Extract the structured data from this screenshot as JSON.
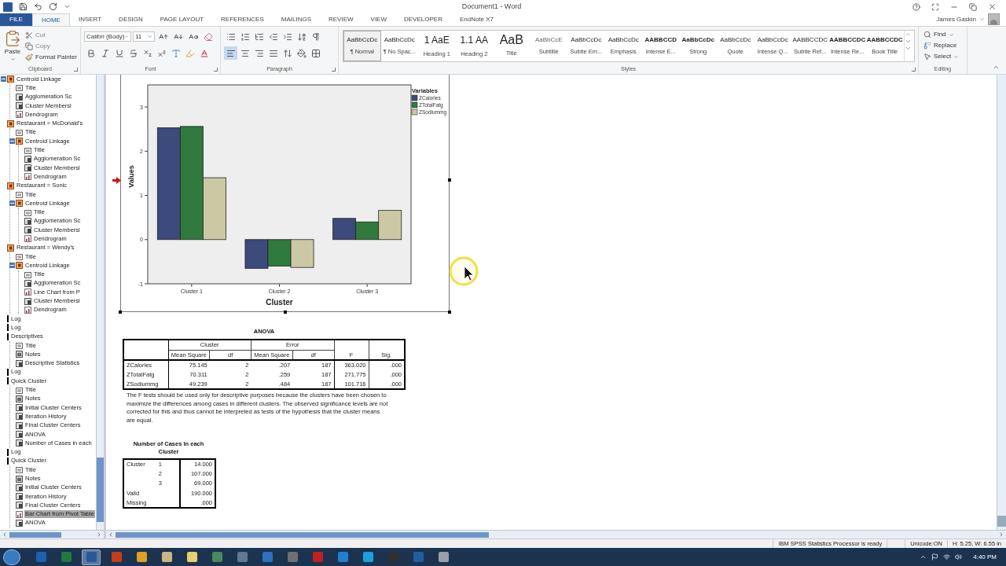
{
  "window": {
    "title": "Document1 - Word"
  },
  "tabs": [
    {
      "label": "FILE",
      "kind": "file",
      "selected": false
    },
    {
      "label": "HOME",
      "kind": "tab",
      "selected": true
    },
    {
      "label": "INSERT",
      "kind": "tab",
      "selected": false
    },
    {
      "label": "DESIGN",
      "kind": "tab",
      "selected": false
    },
    {
      "label": "PAGE LAYOUT",
      "kind": "tab",
      "selected": false
    },
    {
      "label": "REFERENCES",
      "kind": "tab",
      "selected": false
    },
    {
      "label": "MAILINGS",
      "kind": "tab",
      "selected": false
    },
    {
      "label": "REVIEW",
      "kind": "tab",
      "selected": false
    },
    {
      "label": "VIEW",
      "kind": "tab",
      "selected": false
    },
    {
      "label": "DEVELOPER",
      "kind": "tab",
      "selected": false
    },
    {
      "label": "EndNote X7",
      "kind": "tab",
      "selected": false
    }
  ],
  "user": "James Gaskin",
  "ribbon": {
    "clipboard": {
      "label": "Clipboard",
      "paste": "Paste",
      "cut": "Cut",
      "copy": "Copy",
      "format_painter": "Format Painter"
    },
    "font": {
      "label": "Font",
      "font_name": "Calibri (Body)",
      "font_size": "11"
    },
    "paragraph": {
      "label": "Paragraph"
    },
    "styles": {
      "label": "Styles",
      "items": [
        {
          "preview": "AaBbCcDc",
          "label": "¶ Normal",
          "selected": true
        },
        {
          "preview": "AaBbCcDc",
          "label": "¶ No Spac...",
          "selected": false
        },
        {
          "preview": "1 AaE",
          "label": "Heading 1",
          "selected": false
        },
        {
          "preview": "1.1 AA",
          "label": "Heading 2",
          "selected": false
        },
        {
          "preview": "AaB",
          "label": "Title",
          "selected": false
        },
        {
          "preview": "AaBbCcE",
          "label": "Subtitle",
          "selected": false
        },
        {
          "preview": "AaBbCcDc",
          "label": "Subtle Em...",
          "selected": false
        },
        {
          "preview": "AaBbCcDc",
          "label": "Emphasis",
          "selected": false
        },
        {
          "preview": "AABBCCD",
          "label": "Intense E...",
          "selected": false
        },
        {
          "preview": "AaBbCcDc",
          "label": "Strong",
          "selected": false
        },
        {
          "preview": "AaBbCcDc",
          "label": "Quote",
          "selected": false
        },
        {
          "preview": "AaBbCcDc",
          "label": "Intense Q...",
          "selected": false
        },
        {
          "preview": "AABBCCDC",
          "label": "Subtle Ref...",
          "selected": false
        },
        {
          "preview": "AABBCCDC",
          "label": "Intense Re...",
          "selected": false
        },
        {
          "preview": "AABBCCDC",
          "label": "Book Title",
          "selected": false
        }
      ]
    },
    "editing": {
      "label": "Editing",
      "find": "Find",
      "replace": "Replace",
      "select": "Select"
    }
  },
  "outline": [
    {
      "label": "Centroid Linkage",
      "kind": "folder",
      "expanded": true,
      "selected": false,
      "children": [
        {
          "label": "Title",
          "kind": "title",
          "selected": false
        },
        {
          "label": "Agglomeration Sc",
          "kind": "table",
          "selected": false
        },
        {
          "label": "Cluster Membersl",
          "kind": "table",
          "selected": false
        },
        {
          "label": "Dendrogram",
          "kind": "chart",
          "selected": false
        }
      ]
    },
    {
      "label": "Restaurant = McDonald's",
      "kind": "folder",
      "selected": false,
      "children": [
        {
          "label": "Title",
          "kind": "title",
          "selected": false
        },
        {
          "label": "Centroid Linkage",
          "kind": "folder",
          "expanded": true,
          "selected": false,
          "children": [
            {
              "label": "Title",
              "kind": "title",
              "selected": false
            },
            {
              "label": "Agglomeration Sc",
              "kind": "table",
              "selected": false
            },
            {
              "label": "Cluster Membersl",
              "kind": "table",
              "selected": false
            },
            {
              "label": "Dendrogram",
              "kind": "chart",
              "selected": false
            }
          ]
        }
      ]
    },
    {
      "label": "Restaurant = Sonic",
      "kind": "folder",
      "selected": false,
      "children": [
        {
          "label": "Title",
          "kind": "title",
          "selected": false
        },
        {
          "label": "Centroid Linkage",
          "kind": "folder",
          "expanded": true,
          "selected": false,
          "children": [
            {
              "label": "Title",
              "kind": "title",
              "selected": false
            },
            {
              "label": "Agglomeration Sc",
              "kind": "table",
              "selected": false
            },
            {
              "label": "Cluster Membersl",
              "kind": "table",
              "selected": false
            },
            {
              "label": "Dendrogram",
              "kind": "chart",
              "selected": false
            }
          ]
        }
      ]
    },
    {
      "label": "Restaurant = Wendy's",
      "kind": "folder",
      "selected": false,
      "children": [
        {
          "label": "Title",
          "kind": "title",
          "selected": false
        },
        {
          "label": "Centroid Linkage",
          "kind": "folder",
          "expanded": true,
          "selected": false,
          "children": [
            {
              "label": "Title",
              "kind": "title",
              "selected": false
            },
            {
              "label": "Agglomeration Sc",
              "kind": "table",
              "selected": false
            },
            {
              "label": "Line Chart from P",
              "kind": "chart",
              "selected": false
            },
            {
              "label": "Cluster Membersl",
              "kind": "table",
              "selected": false
            },
            {
              "label": "Dendrogram",
              "kind": "chart",
              "selected": false
            }
          ]
        }
      ]
    },
    {
      "label": "Log",
      "kind": "log",
      "selected": false
    },
    {
      "label": "Log",
      "kind": "log",
      "selected": false
    },
    {
      "label": "Descriptives",
      "kind": "log",
      "selected": false,
      "children": [
        {
          "label": "Title",
          "kind": "title",
          "selected": false
        },
        {
          "label": "Notes",
          "kind": "notes",
          "selected": false
        },
        {
          "label": "Descriptive Statistics",
          "kind": "table",
          "selected": false
        }
      ]
    },
    {
      "label": "Log",
      "kind": "log",
      "selected": false
    },
    {
      "label": "Quick Cluster",
      "kind": "log",
      "selected": false,
      "children": [
        {
          "label": "Title",
          "kind": "title",
          "selected": false
        },
        {
          "label": "Notes",
          "kind": "notes",
          "selected": false
        },
        {
          "label": "Initial Cluster Centers",
          "kind": "table",
          "selected": false
        },
        {
          "label": "Iteration History",
          "kind": "table",
          "selected": false
        },
        {
          "label": "Final Cluster Centers",
          "kind": "table",
          "selected": false
        },
        {
          "label": "ANOVA",
          "kind": "table",
          "selected": false
        },
        {
          "label": "Number of Cases in each",
          "kind": "table",
          "selected": false
        }
      ]
    },
    {
      "label": "Log",
      "kind": "log",
      "selected": false
    },
    {
      "label": "Quick Cluster",
      "kind": "log",
      "selected": false,
      "children": [
        {
          "label": "Title",
          "kind": "title",
          "selected": false
        },
        {
          "label": "Notes",
          "kind": "notes",
          "selected": false
        },
        {
          "label": "Initial Cluster Centers",
          "kind": "table",
          "selected": false
        },
        {
          "label": "Iteration History",
          "kind": "table",
          "selected": false
        },
        {
          "label": "Final Cluster Centers",
          "kind": "table",
          "selected": false
        },
        {
          "label": "Bar Chart from Pivot Table",
          "kind": "chart",
          "selected": true
        },
        {
          "label": "ANOVA",
          "kind": "table",
          "selected": false
        }
      ]
    }
  ],
  "chart": {
    "legend_title": "Variables",
    "chart_data": {
      "type": "bar",
      "xlabel": "Cluster",
      "ylabel": "Values",
      "categories": [
        "Cluster 1",
        "Cluster 2",
        "Cluster 3"
      ],
      "series": [
        {
          "name": "ZCalories",
          "color": "#3c4a7c",
          "values": [
            2.53,
            -0.65,
            0.48
          ]
        },
        {
          "name": "ZTotalFatg",
          "color": "#2f7a3c",
          "values": [
            2.56,
            -0.6,
            0.4
          ]
        },
        {
          "name": "ZSodiummg",
          "color": "#cdc8a4",
          "values": [
            1.4,
            -0.63,
            0.66
          ]
        }
      ],
      "ylim": [
        -1,
        3.5
      ],
      "yticks": [
        -1,
        0,
        1,
        2,
        3
      ],
      "legend": "right"
    }
  },
  "anova": {
    "title": "ANOVA",
    "groups": [
      "Cluster",
      "Error"
    ],
    "subcolumns": [
      "Mean Square",
      "df",
      "Mean Square",
      "df"
    ],
    "extra_columns": [
      "F",
      "Sig."
    ],
    "rows": [
      {
        "label": "ZCalories",
        "values": [
          "75.145",
          "2",
          ".207",
          "187",
          "363.020",
          ".000"
        ]
      },
      {
        "label": "ZTotalFatg",
        "values": [
          "70.311",
          "2",
          ".259",
          "187",
          "271.775",
          ".000"
        ]
      },
      {
        "label": "ZSodiummg",
        "values": [
          "49.239",
          "2",
          ".484",
          "187",
          "101.716",
          ".000"
        ]
      }
    ],
    "footnote": "The F tests should be used only for descriptive purposes because the clusters have been chosen to maximize the differences among cases in different clusters. The observed significance levels are not corrected for this and thus cannot be interpreted as tests of the hypothesis that the cluster means are equal."
  },
  "cases": {
    "title": "Number of Cases in each Cluster",
    "rows": [
      {
        "label": "Cluster",
        "sub": "1",
        "value": "14.000"
      },
      {
        "sub": "2",
        "value": "107.000"
      },
      {
        "sub": "3",
        "value": "69.000"
      },
      {
        "label": "Valid",
        "value": "190.000"
      },
      {
        "label": "Missing",
        "value": ".000"
      }
    ]
  },
  "status_bar": {
    "message": "IBM SPSS Statistics Processor is ready",
    "unicode": "Unicode:ON",
    "size": "H: 5.25, W: 6.55 in"
  },
  "taskbar": {
    "apps": [
      {
        "color": "#1e5fb4",
        "selected": false
      },
      {
        "color": "#1f7a3d",
        "selected": false
      },
      {
        "color": "#2b579a",
        "selected": true
      },
      {
        "color": "#c43e1c",
        "selected": false
      },
      {
        "color": "#e0a020",
        "selected": false
      },
      {
        "color": "#c8b880",
        "selected": false
      },
      {
        "color": "#e8d070",
        "selected": false
      },
      {
        "color": "#4a8a5a",
        "selected": false
      },
      {
        "color": "#607890",
        "selected": false
      },
      {
        "color": "#3070c0",
        "selected": false
      },
      {
        "color": "#707070",
        "selected": false
      },
      {
        "color": "#c02020",
        "selected": false
      },
      {
        "color": "#2080d0",
        "selected": false
      },
      {
        "color": "#1aa0e0",
        "selected": false
      },
      {
        "color": "#303030",
        "selected": false
      },
      {
        "color": "#2060a0",
        "selected": false
      },
      {
        "color": "#9aa0a8",
        "selected": false
      }
    ],
    "time": "4:40 PM"
  }
}
